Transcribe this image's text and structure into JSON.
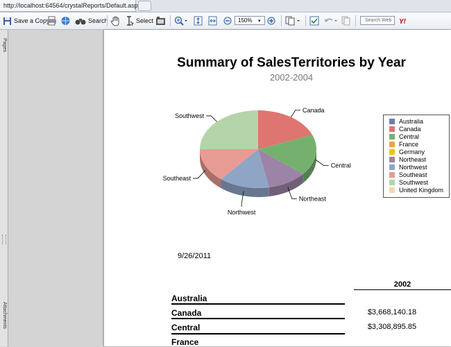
{
  "browser": {
    "tab_title": "http://localhost:64564/crystalReports/Default.aspx"
  },
  "toolbar": {
    "save_copy_label": "Save a Copy",
    "search_label": "Search",
    "select_label": "Select",
    "zoom_value": "150%",
    "search_placeholder": "Search Web"
  },
  "side_panel": {
    "pages_label": "Pages",
    "attachments_label": "Attachments"
  },
  "report": {
    "title": "Summary of SalesTerritories by Year",
    "subtitle": "2002-2004",
    "date": "9/26/2011",
    "column_header": "2002",
    "rows": [
      {
        "label": "Australia",
        "value": ""
      },
      {
        "label": "Canada",
        "value": "$3,668,140.18"
      },
      {
        "label": "Central",
        "value": "$3,308,895.85"
      },
      {
        "label": "France",
        "value": ""
      }
    ]
  },
  "chart_data": {
    "type": "pie",
    "title": "Summary of SalesTerritories by Year",
    "subtitle": "2002-2004",
    "legend_position": "right",
    "categories": [
      "Australia",
      "Canada",
      "Central",
      "France",
      "Germany",
      "Northeast",
      "Northwest",
      "Southeast",
      "Southwest",
      "United Kingdom"
    ],
    "colors": [
      "#6a80a8",
      "#df7570",
      "#76b06f",
      "#f0a14a",
      "#e8c800",
      "#9d84a6",
      "#8fa5c6",
      "#e89b92",
      "#b4d4aa",
      "#f9d6b0"
    ],
    "slices": [
      {
        "label": "Canada",
        "percent": 19,
        "color": "#df7570"
      },
      {
        "label": "Central",
        "percent": 17,
        "color": "#76b06f"
      },
      {
        "label": "Northeast",
        "percent": 11,
        "color": "#9d84a6"
      },
      {
        "label": "Northwest",
        "percent": 14,
        "color": "#8fa5c6"
      },
      {
        "label": "Southeast",
        "percent": 14,
        "color": "#e89b92"
      },
      {
        "label": "Southwest",
        "percent": 25,
        "color": "#b4d4aa"
      }
    ]
  }
}
